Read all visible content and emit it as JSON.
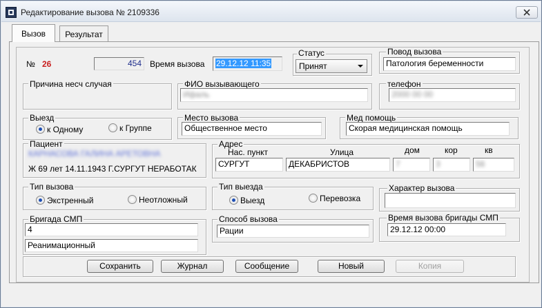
{
  "window": {
    "title": "Редактирование вызова № 2109336"
  },
  "tabs": [
    {
      "label": "Вызов"
    },
    {
      "label": "Результат"
    }
  ],
  "call": {
    "number_prefix": "№",
    "number": "26",
    "card_number": "454",
    "time_label": "Время вызова",
    "time_value": "29.12.12 11:35"
  },
  "status": {
    "label": "Статус",
    "value": "Принят"
  },
  "reason": {
    "label": "Повод вызова",
    "value": "Патология беременности"
  },
  "accident_cause": {
    "label": "Причина несч случая"
  },
  "caller": {
    "label": "ФИО вызывающего",
    "value": "Ифаль"
  },
  "phone": {
    "label": "телефон",
    "value": "2000 00 00"
  },
  "departure": {
    "label": "Выезд",
    "option_single": "к Одному",
    "option_group": "к Группе",
    "selected": "к Одному"
  },
  "call_place": {
    "label": "Место вызова",
    "value": "Общественное место"
  },
  "med_help": {
    "label": "Мед помощь",
    "value": "Скорая медицинская помощь"
  },
  "patient": {
    "label": "Пациент",
    "name": "КАРНАСОВА ГАЛИНА АРЕТОВНА",
    "details": "Ж 69 лет  14.11.1943 Г.СУРГУТ НЕРАБОТАК"
  },
  "address": {
    "label": "Адрес",
    "settlement_label": "Нас. пункт",
    "street_label": "Улица",
    "house_label": "дом",
    "building_label": "кор",
    "apartment_label": "кв",
    "settlement": "СУРГУТ",
    "street": "ДЕКАБРИСТОВ",
    "house": "7",
    "building": "3",
    "apartment": "56"
  },
  "call_type": {
    "label": "Тип вызова",
    "option_emergency": "Экстренный",
    "option_urgent": "Неотложный",
    "selected": "Экстренный"
  },
  "departure_type": {
    "label": "Тип выезда",
    "option_trip": "Выезд",
    "option_transport": "Перевозка",
    "selected": "Выезд"
  },
  "call_nature": {
    "label": "Характер вызова",
    "value": ""
  },
  "team": {
    "label": "Бригада СМП",
    "number": "4",
    "type": "Реанимационный"
  },
  "call_method": {
    "label": "Способ вызова",
    "value": "Рации"
  },
  "team_call_time": {
    "label": "Время вызова бригады СМП",
    "value": "29.12.12 00:00"
  },
  "buttons": {
    "save": "Сохранить",
    "journal": "Журнал",
    "message": "Сообщение",
    "new": "Новый",
    "copy": "Копия"
  }
}
